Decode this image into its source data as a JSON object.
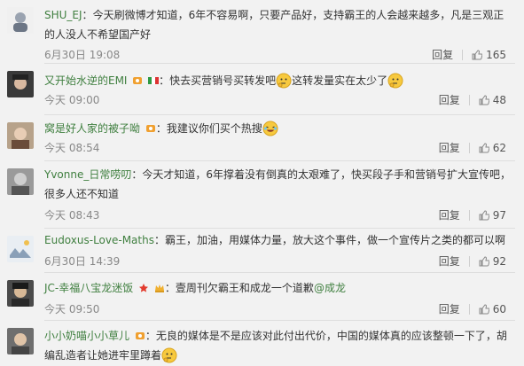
{
  "comments": [
    {
      "user": "SHU_EJ",
      "sep": "：",
      "text": "今天刷微博才知道，6年不容易啊，只要产品好，支持霸王的人会越来越多，凡是三观正的人没人不希望国产好",
      "time": "6月30日 19:08",
      "reply": "回复",
      "likes": "165"
    },
    {
      "user": "又开始水逆的EMI",
      "sep": "：",
      "text_a": "快去买营销号买转发吧",
      "text_b": "这转发量实在太少了",
      "time": "今天 09:00",
      "reply": "回复",
      "likes": "48"
    },
    {
      "user": "窝是好人家的被子呦",
      "sep": "：",
      "text": "我建议你们买个热搜",
      "time": "今天 08:54",
      "reply": "回复",
      "likes": "62"
    },
    {
      "user": "Yvonne_日常唠叨",
      "sep": "：",
      "text": "今天才知道，6年撑着没有倒真的太艰难了，快买段子手和营销号扩大宣传吧，很多人还不知道",
      "time": "今天 08:43",
      "reply": "回复",
      "likes": "97"
    },
    {
      "user": "Eudoxus-Love-Maths",
      "sep": "：",
      "text": "霸王，加油，用媒体力量，放大这个事件，做一个宣传片之类的都可以啊",
      "time": "6月30日 14:39",
      "reply": "回复",
      "likes": "92"
    },
    {
      "user": "JC-幸福八宝龙迷饭",
      "sep": "：",
      "text": "壹周刊欠霸王和成龙一个道歉",
      "mention": "@成龙",
      "time": "今天 09:50",
      "reply": "回复",
      "likes": "60"
    },
    {
      "user": "小小奶喵小小草儿",
      "sep": "：",
      "text": "无良的媒体是不是应该对此付出代价，中国的媒体真的应该整顿一下了，胡编乱造者让她进牢里蹲着",
      "time": "",
      "reply": "",
      "likes": ""
    }
  ],
  "colors": {
    "username": "#3f7f3f",
    "meta": "#888888",
    "text": "#333333",
    "bg": "#f2f2f2"
  }
}
